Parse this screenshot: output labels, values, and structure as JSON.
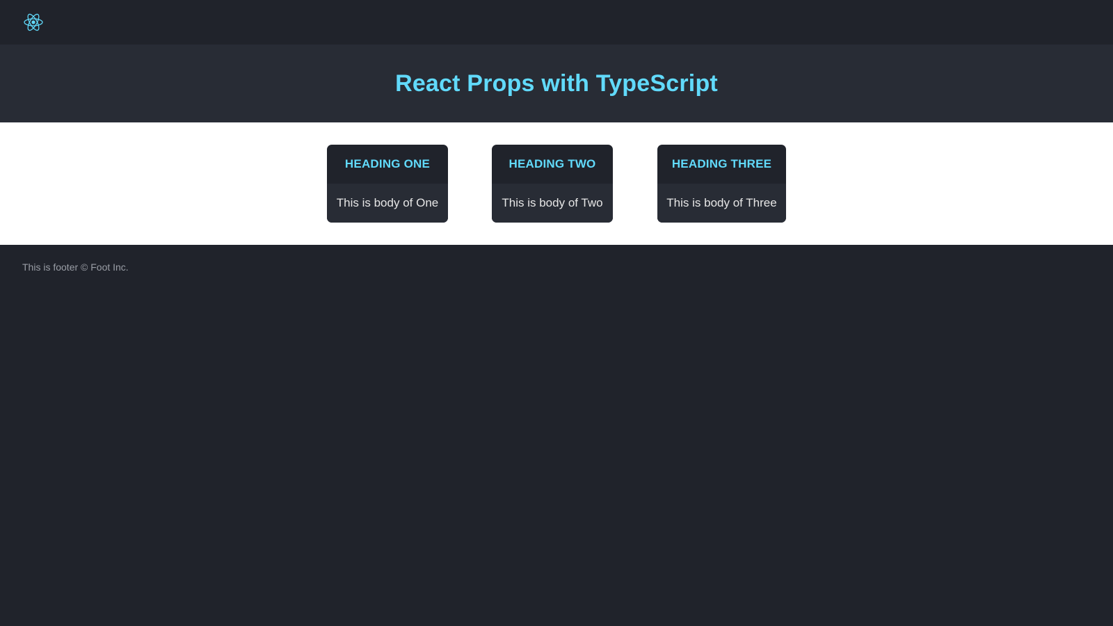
{
  "navbar": {
    "logo_icon": "react-atom-icon",
    "accent_color": "#61dafb"
  },
  "hero": {
    "title": "React Props with TypeScript"
  },
  "cards": [
    {
      "heading": "HEADING ONE",
      "body": "This is body of One"
    },
    {
      "heading": "HEADING TWO",
      "body": "This is body of Two"
    },
    {
      "heading": "HEADING THREE",
      "body": "This is body of Three"
    }
  ],
  "footer": {
    "text": "This is footer © Foot Inc."
  },
  "colors": {
    "background": "#20232b",
    "hero_background": "#282c35",
    "content_background": "#ffffff",
    "accent": "#61dafb"
  }
}
